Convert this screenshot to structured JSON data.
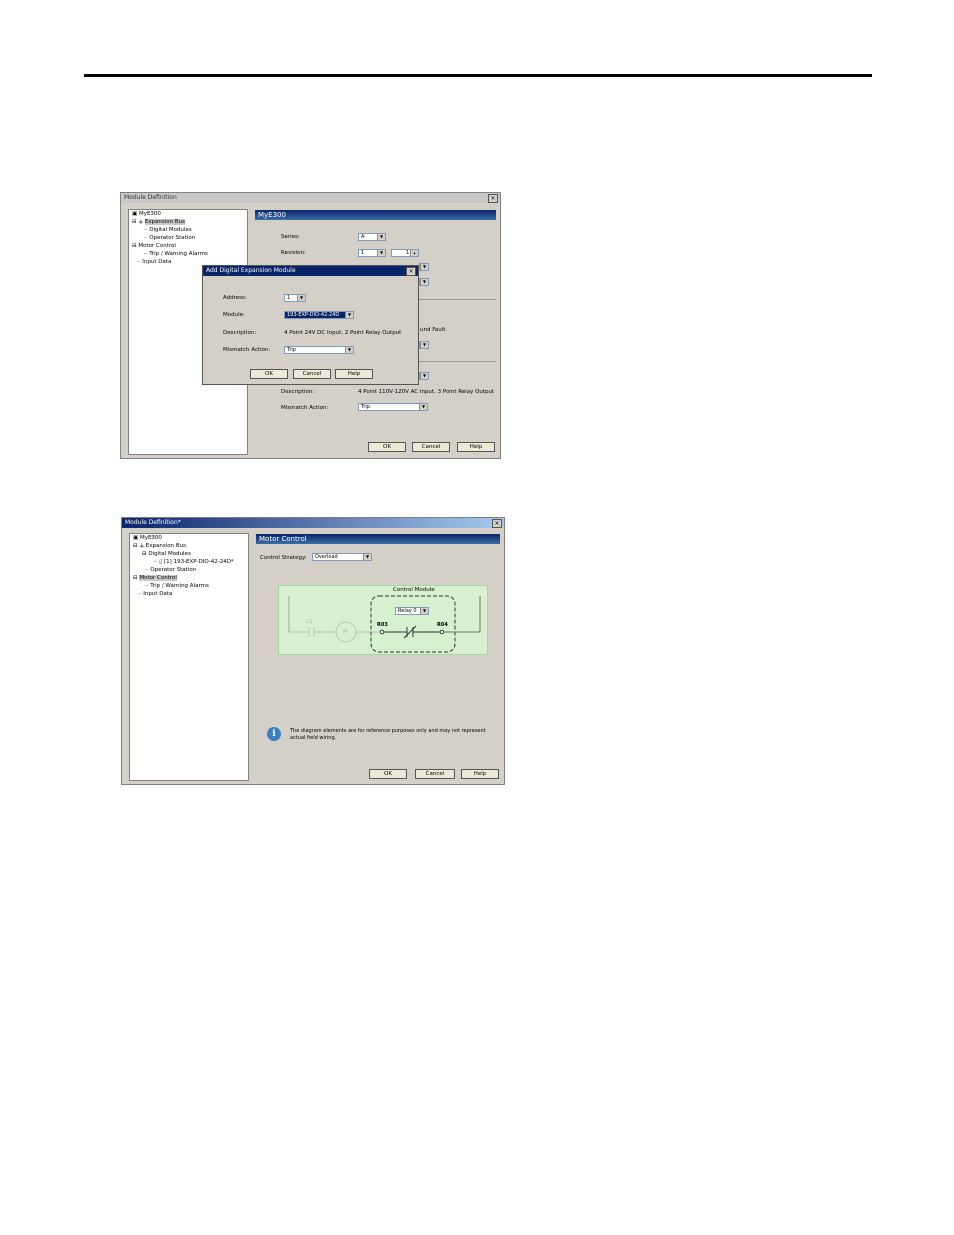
{
  "dialog1": {
    "title": "Module Definition",
    "close": "×",
    "tree": {
      "root": "MyE300",
      "expansion_bus": "Expansion Bus",
      "digital_modules": "Digital Modules",
      "operator_station": "Operator Station",
      "motor_control": "Motor Control",
      "trip_warning": "Trip / Warning Alarms",
      "input_data": "Input Data"
    },
    "header": "MyE300",
    "series_label": "Series:",
    "series_value": "A",
    "revision_label": "Revision:",
    "revision_major": "1",
    "revision_minor": "1",
    "fault_fragment": "und Fault",
    "description_label": "Description:",
    "description_value": "4 Point 110V-120V AC Input, 3 Point Relay Output",
    "mismatch_label": "Mismatch Action:",
    "mismatch_value": "Trip",
    "ok": "OK",
    "cancel": "Cancel",
    "help": "Help"
  },
  "popup": {
    "title": "Add Digital Expansion Module",
    "close": "×",
    "address_label": "Address:",
    "address_value": "1",
    "module_label": "Module:",
    "module_value": "193-EXP-DIO-42-24D",
    "description_label": "Description:",
    "description_value": "4 Point 24V DC Input, 2 Point Relay Output",
    "mismatch_label": "Mismatch Action:",
    "mismatch_value": "Trip",
    "ok": "OK",
    "cancel": "Cancel",
    "help": "Help"
  },
  "dialog2": {
    "title": "Module Definition*",
    "close": "×",
    "tree": {
      "root": "MyE300",
      "expansion_bus": "Expansion Bus",
      "digital_modules": "Digital Modules",
      "module_entry": "[1] 193-EXP-DIO-42-24D*",
      "operator_station": "Operator Station",
      "motor_control": "Motor Control",
      "trip_warning": "Trip / Warning Alarms",
      "input_data": "Input Data"
    },
    "header": "Motor Control",
    "strategy_label": "Control Strategy:",
    "strategy_value": "Overload",
    "control_module_label": "Control Module",
    "relay_value": "Relay 0",
    "l1": "L1",
    "motor": "M",
    "ro3": "R03",
    "ro4": "R04",
    "info_text": "The diagram elements are for reference purposes only and may not represent actual field wiring.",
    "ok": "OK",
    "cancel": "Cancel",
    "help": "Help"
  }
}
